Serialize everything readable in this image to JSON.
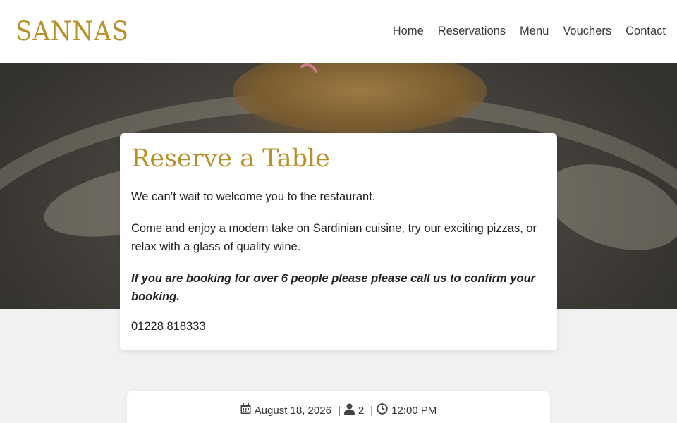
{
  "brand": {
    "logo_text": "SANNAS",
    "color": "#b8902a"
  },
  "nav": {
    "items": [
      {
        "label": "Home"
      },
      {
        "label": "Reservations"
      },
      {
        "label": "Menu"
      },
      {
        "label": "Vouchers"
      },
      {
        "label": "Contact"
      }
    ]
  },
  "card": {
    "title": "Reserve a Table",
    "intro": "We can’t wait to welcome you to the restaurant.",
    "description": "Come and enjoy a modern take on Sardinian cuisine, try our exciting pizzas, or relax with a glass of quality wine.",
    "notice": "If you are booking for over 6 people please please call us to confirm your booking.",
    "phone": "01228 818333"
  },
  "booking": {
    "date": "August 18, 2026",
    "guests": "2",
    "time": "12:00 PM",
    "separator": "|",
    "icons": {
      "date": "calendar-icon",
      "guests": "person-icon",
      "time": "clock-icon"
    }
  }
}
